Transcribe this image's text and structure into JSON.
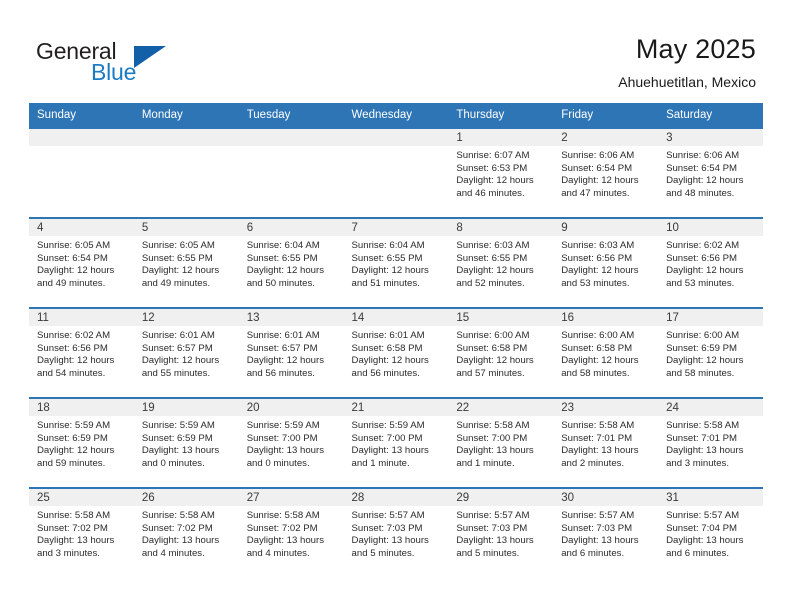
{
  "brand": {
    "name_top": "General",
    "name_bottom": "Blue",
    "accent_color": "#1b7bc4",
    "triangle_color": "#1260a8"
  },
  "header": {
    "title": "May 2025",
    "subtitle": "Ahuehuetitlan, Mexico"
  },
  "theme": {
    "header_bg": "#2e75b6",
    "daynum_bg": "#f0f0f0",
    "cell_bg": "#ffffff",
    "text_color": "#2b2b2b"
  },
  "weekday_headers": [
    "Sunday",
    "Monday",
    "Tuesday",
    "Wednesday",
    "Thursday",
    "Friday",
    "Saturday"
  ],
  "weeks": [
    [
      {
        "day": "",
        "sunrise": "",
        "sunset": "",
        "daylight1": "",
        "daylight2": "",
        "empty": true
      },
      {
        "day": "",
        "sunrise": "",
        "sunset": "",
        "daylight1": "",
        "daylight2": "",
        "empty": true
      },
      {
        "day": "",
        "sunrise": "",
        "sunset": "",
        "daylight1": "",
        "daylight2": "",
        "empty": true
      },
      {
        "day": "",
        "sunrise": "",
        "sunset": "",
        "daylight1": "",
        "daylight2": "",
        "empty": true
      },
      {
        "day": "1",
        "sunrise": "Sunrise: 6:07 AM",
        "sunset": "Sunset: 6:53 PM",
        "daylight1": "Daylight: 12 hours",
        "daylight2": "and 46 minutes."
      },
      {
        "day": "2",
        "sunrise": "Sunrise: 6:06 AM",
        "sunset": "Sunset: 6:54 PM",
        "daylight1": "Daylight: 12 hours",
        "daylight2": "and 47 minutes."
      },
      {
        "day": "3",
        "sunrise": "Sunrise: 6:06 AM",
        "sunset": "Sunset: 6:54 PM",
        "daylight1": "Daylight: 12 hours",
        "daylight2": "and 48 minutes."
      }
    ],
    [
      {
        "day": "4",
        "sunrise": "Sunrise: 6:05 AM",
        "sunset": "Sunset: 6:54 PM",
        "daylight1": "Daylight: 12 hours",
        "daylight2": "and 49 minutes."
      },
      {
        "day": "5",
        "sunrise": "Sunrise: 6:05 AM",
        "sunset": "Sunset: 6:55 PM",
        "daylight1": "Daylight: 12 hours",
        "daylight2": "and 49 minutes."
      },
      {
        "day": "6",
        "sunrise": "Sunrise: 6:04 AM",
        "sunset": "Sunset: 6:55 PM",
        "daylight1": "Daylight: 12 hours",
        "daylight2": "and 50 minutes."
      },
      {
        "day": "7",
        "sunrise": "Sunrise: 6:04 AM",
        "sunset": "Sunset: 6:55 PM",
        "daylight1": "Daylight: 12 hours",
        "daylight2": "and 51 minutes."
      },
      {
        "day": "8",
        "sunrise": "Sunrise: 6:03 AM",
        "sunset": "Sunset: 6:55 PM",
        "daylight1": "Daylight: 12 hours",
        "daylight2": "and 52 minutes."
      },
      {
        "day": "9",
        "sunrise": "Sunrise: 6:03 AM",
        "sunset": "Sunset: 6:56 PM",
        "daylight1": "Daylight: 12 hours",
        "daylight2": "and 53 minutes."
      },
      {
        "day": "10",
        "sunrise": "Sunrise: 6:02 AM",
        "sunset": "Sunset: 6:56 PM",
        "daylight1": "Daylight: 12 hours",
        "daylight2": "and 53 minutes."
      }
    ],
    [
      {
        "day": "11",
        "sunrise": "Sunrise: 6:02 AM",
        "sunset": "Sunset: 6:56 PM",
        "daylight1": "Daylight: 12 hours",
        "daylight2": "and 54 minutes."
      },
      {
        "day": "12",
        "sunrise": "Sunrise: 6:01 AM",
        "sunset": "Sunset: 6:57 PM",
        "daylight1": "Daylight: 12 hours",
        "daylight2": "and 55 minutes."
      },
      {
        "day": "13",
        "sunrise": "Sunrise: 6:01 AM",
        "sunset": "Sunset: 6:57 PM",
        "daylight1": "Daylight: 12 hours",
        "daylight2": "and 56 minutes."
      },
      {
        "day": "14",
        "sunrise": "Sunrise: 6:01 AM",
        "sunset": "Sunset: 6:58 PM",
        "daylight1": "Daylight: 12 hours",
        "daylight2": "and 56 minutes."
      },
      {
        "day": "15",
        "sunrise": "Sunrise: 6:00 AM",
        "sunset": "Sunset: 6:58 PM",
        "daylight1": "Daylight: 12 hours",
        "daylight2": "and 57 minutes."
      },
      {
        "day": "16",
        "sunrise": "Sunrise: 6:00 AM",
        "sunset": "Sunset: 6:58 PM",
        "daylight1": "Daylight: 12 hours",
        "daylight2": "and 58 minutes."
      },
      {
        "day": "17",
        "sunrise": "Sunrise: 6:00 AM",
        "sunset": "Sunset: 6:59 PM",
        "daylight1": "Daylight: 12 hours",
        "daylight2": "and 58 minutes."
      }
    ],
    [
      {
        "day": "18",
        "sunrise": "Sunrise: 5:59 AM",
        "sunset": "Sunset: 6:59 PM",
        "daylight1": "Daylight: 12 hours",
        "daylight2": "and 59 minutes."
      },
      {
        "day": "19",
        "sunrise": "Sunrise: 5:59 AM",
        "sunset": "Sunset: 6:59 PM",
        "daylight1": "Daylight: 13 hours",
        "daylight2": "and 0 minutes."
      },
      {
        "day": "20",
        "sunrise": "Sunrise: 5:59 AM",
        "sunset": "Sunset: 7:00 PM",
        "daylight1": "Daylight: 13 hours",
        "daylight2": "and 0 minutes."
      },
      {
        "day": "21",
        "sunrise": "Sunrise: 5:59 AM",
        "sunset": "Sunset: 7:00 PM",
        "daylight1": "Daylight: 13 hours",
        "daylight2": "and 1 minute."
      },
      {
        "day": "22",
        "sunrise": "Sunrise: 5:58 AM",
        "sunset": "Sunset: 7:00 PM",
        "daylight1": "Daylight: 13 hours",
        "daylight2": "and 1 minute."
      },
      {
        "day": "23",
        "sunrise": "Sunrise: 5:58 AM",
        "sunset": "Sunset: 7:01 PM",
        "daylight1": "Daylight: 13 hours",
        "daylight2": "and 2 minutes."
      },
      {
        "day": "24",
        "sunrise": "Sunrise: 5:58 AM",
        "sunset": "Sunset: 7:01 PM",
        "daylight1": "Daylight: 13 hours",
        "daylight2": "and 3 minutes."
      }
    ],
    [
      {
        "day": "25",
        "sunrise": "Sunrise: 5:58 AM",
        "sunset": "Sunset: 7:02 PM",
        "daylight1": "Daylight: 13 hours",
        "daylight2": "and 3 minutes."
      },
      {
        "day": "26",
        "sunrise": "Sunrise: 5:58 AM",
        "sunset": "Sunset: 7:02 PM",
        "daylight1": "Daylight: 13 hours",
        "daylight2": "and 4 minutes."
      },
      {
        "day": "27",
        "sunrise": "Sunrise: 5:58 AM",
        "sunset": "Sunset: 7:02 PM",
        "daylight1": "Daylight: 13 hours",
        "daylight2": "and 4 minutes."
      },
      {
        "day": "28",
        "sunrise": "Sunrise: 5:57 AM",
        "sunset": "Sunset: 7:03 PM",
        "daylight1": "Daylight: 13 hours",
        "daylight2": "and 5 minutes."
      },
      {
        "day": "29",
        "sunrise": "Sunrise: 5:57 AM",
        "sunset": "Sunset: 7:03 PM",
        "daylight1": "Daylight: 13 hours",
        "daylight2": "and 5 minutes."
      },
      {
        "day": "30",
        "sunrise": "Sunrise: 5:57 AM",
        "sunset": "Sunset: 7:03 PM",
        "daylight1": "Daylight: 13 hours",
        "daylight2": "and 6 minutes."
      },
      {
        "day": "31",
        "sunrise": "Sunrise: 5:57 AM",
        "sunset": "Sunset: 7:04 PM",
        "daylight1": "Daylight: 13 hours",
        "daylight2": "and 6 minutes."
      }
    ]
  ]
}
